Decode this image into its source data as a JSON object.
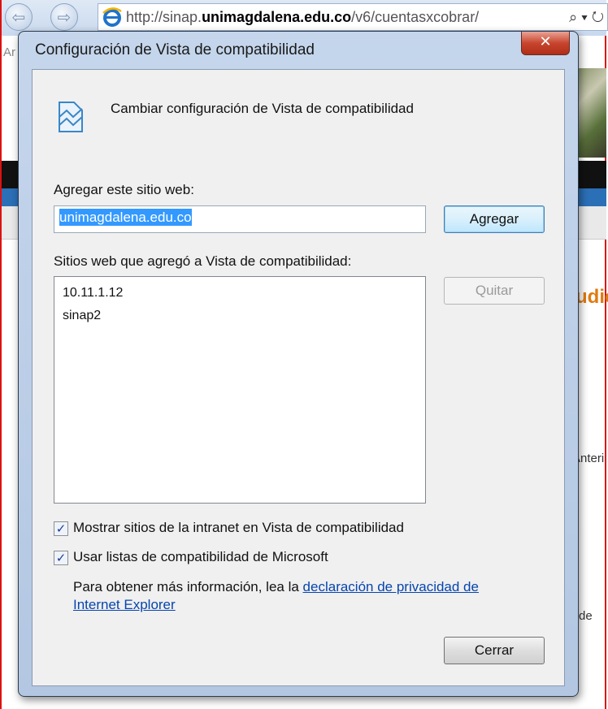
{
  "browser": {
    "url_prefix": "http://sinap.",
    "url_host": "unimagdalena.edu.co",
    "url_suffix": "/v6/cuentasxcobrar/",
    "tools": "⌕ ▾ ↻"
  },
  "background_page": {
    "fragment_1": "udio",
    "fragment_2": "Anteri",
    "fragment_3": "de",
    "fragment_4": "Ar"
  },
  "dialog": {
    "title": "Configuración de Vista de compatibilidad",
    "close_label": "✕",
    "header_text": "Cambiar configuración de Vista de compatibilidad",
    "add_site_label": "Agregar este sitio web:",
    "add_site_value": "unimagdalena.edu.co",
    "add_button": "Agregar",
    "list_label": "Sitios web que agregó a Vista de compatibilidad:",
    "sites": [
      "10.11.1.12",
      "sinap2"
    ],
    "remove_button": "Quitar",
    "check_intranet": "Mostrar sitios de la intranet en Vista de compatibilidad",
    "check_microsoft": "Usar listas de compatibilidad de Microsoft",
    "info_text": "Para obtener más información, lea la ",
    "info_link": "declaración de privacidad de Internet Explorer",
    "close_button": "Cerrar"
  },
  "colors": {
    "selection": "#3399ff",
    "link": "#0645ad",
    "close_red": "#c8452e"
  }
}
